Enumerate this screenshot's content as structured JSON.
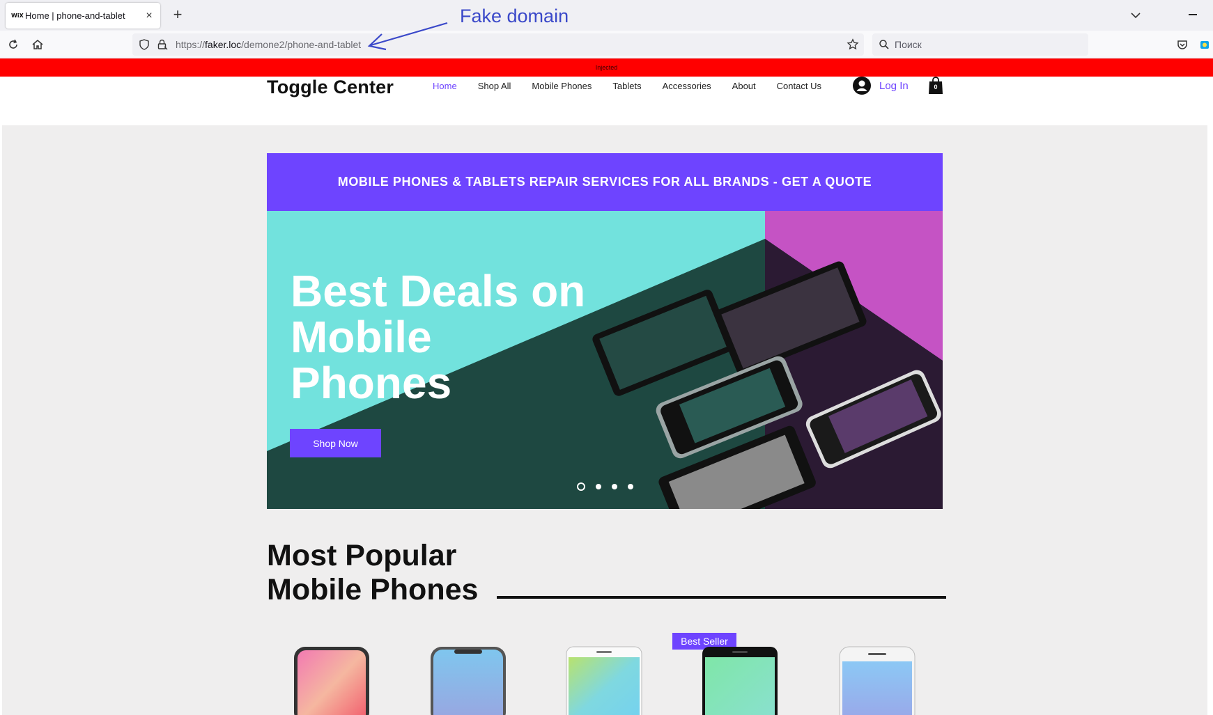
{
  "browser": {
    "tab_title": "Home | phone-and-tablet",
    "tab_favicon": "WiX",
    "new_tab_glyph": "+",
    "close_glyph": "×",
    "url_prefix": "https://",
    "url_host": "faker.loc",
    "url_path": "/demone2/phone-and-tablet",
    "search_placeholder": "Поиск"
  },
  "annotation": {
    "text": "Fake domain",
    "color": "#3a48c9"
  },
  "injected_banner": {
    "text": "Injected",
    "color": "#ff0000"
  },
  "site": {
    "logo": "Toggle Center",
    "menu": [
      {
        "label": "Home",
        "active": true
      },
      {
        "label": "Shop All",
        "active": false
      },
      {
        "label": "Mobile Phones",
        "active": false
      },
      {
        "label": "Tablets",
        "active": false
      },
      {
        "label": "Accessories",
        "active": false
      },
      {
        "label": "About",
        "active": false
      },
      {
        "label": "Contact Us",
        "active": false
      }
    ],
    "login_label": "Log In",
    "cart_count": "0",
    "accent_color": "#6e44ff"
  },
  "promo": {
    "text": "MOBILE PHONES & TABLETS REPAIR SERVICES FOR ALL BRANDS - GET A QUOTE"
  },
  "hero": {
    "title_line1": "Best Deals on",
    "title_line2": "Mobile",
    "title_line3": "Phones",
    "cta_label": "Shop Now",
    "slides_total": 4,
    "active_slide": 1
  },
  "section": {
    "title_line1": "Most Popular",
    "title_line2": "Mobile Phones"
  },
  "products": {
    "badge_label": "Best Seller",
    "items": [
      {
        "name": "phone-1"
      },
      {
        "name": "phone-2"
      },
      {
        "name": "phone-3"
      },
      {
        "name": "phone-4"
      },
      {
        "name": "phone-5"
      }
    ]
  },
  "icons": {
    "reload": "reload-icon",
    "home": "home-icon",
    "shield": "tracking-shield-icon",
    "lock": "lock-icon",
    "bookmark": "star-icon",
    "search": "search-icon",
    "pocket": "pocket-icon",
    "extension": "extension-icon",
    "user": "user-avatar-icon",
    "cart": "shopping-bag-icon"
  }
}
